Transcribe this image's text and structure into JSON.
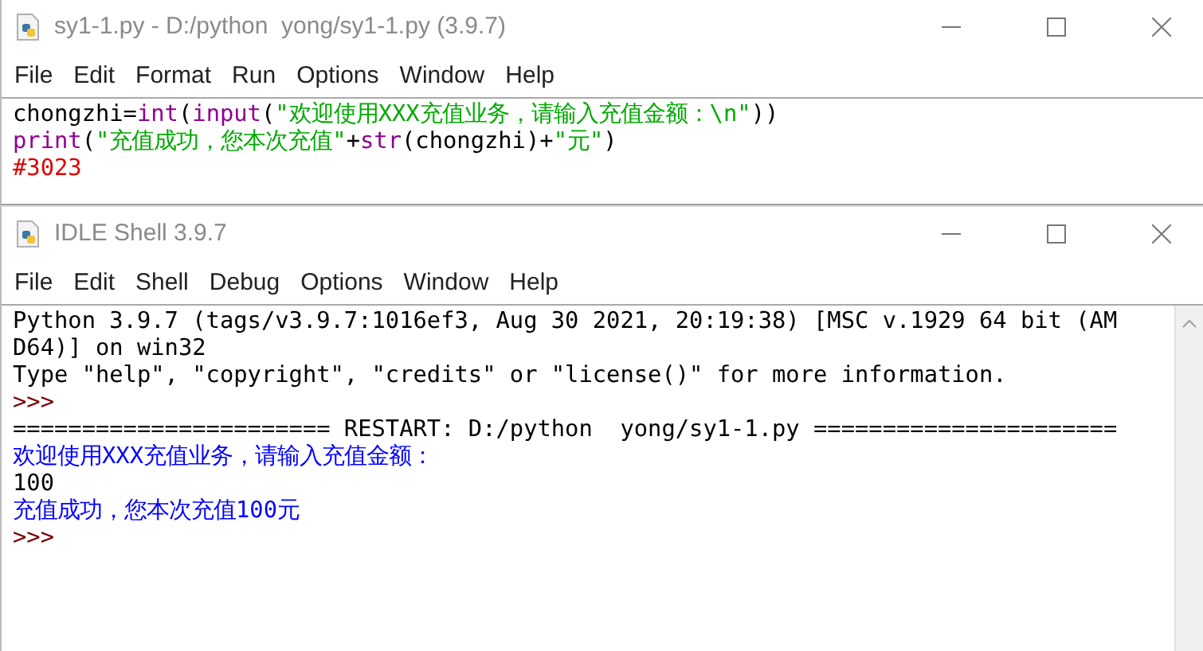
{
  "editor": {
    "title": "sy1-1.py - D:/python  yong/sy1-1.py (3.9.7)",
    "menu": [
      "File",
      "Edit",
      "Format",
      "Run",
      "Options",
      "Window",
      "Help"
    ],
    "lines": [
      [
        {
          "text": "chongzhi=",
          "kind": "plain"
        },
        {
          "text": "int",
          "kind": "builtin"
        },
        {
          "text": "(",
          "kind": "plain"
        },
        {
          "text": "input",
          "kind": "builtin"
        },
        {
          "text": "(",
          "kind": "plain"
        },
        {
          "text": "\"欢迎使用XXX充值业务，请输入充值金额：\\n\"",
          "kind": "string"
        },
        {
          "text": "))",
          "kind": "plain"
        }
      ],
      [
        {
          "text": "print",
          "kind": "builtin"
        },
        {
          "text": "(",
          "kind": "plain"
        },
        {
          "text": "\"充值成功，您本次充值\"",
          "kind": "string"
        },
        {
          "text": "+",
          "kind": "plain"
        },
        {
          "text": "str",
          "kind": "builtin"
        },
        {
          "text": "(chongzhi)+",
          "kind": "plain"
        },
        {
          "text": "\"元\"",
          "kind": "string"
        },
        {
          "text": ")",
          "kind": "plain"
        }
      ],
      [
        {
          "text": "#3023",
          "kind": "comment"
        }
      ]
    ]
  },
  "shell": {
    "title": "IDLE Shell 3.9.7",
    "menu": [
      "File",
      "Edit",
      "Shell",
      "Debug",
      "Options",
      "Window",
      "Help"
    ],
    "lines": [
      [
        {
          "text": "Python 3.9.7 (tags/v3.9.7:1016ef3, Aug 30 2021, 20:19:38) [MSC v.1929 64 bit (AM",
          "kind": "plain"
        }
      ],
      [
        {
          "text": "D64)] on win32",
          "kind": "plain"
        }
      ],
      [
        {
          "text": "Type \"help\", \"copyright\", \"credits\" or \"license()\" for more information.",
          "kind": "plain"
        }
      ],
      [
        {
          "text": ">>>",
          "kind": "prompt"
        }
      ],
      [
        {
          "text": "======================= RESTART: D:/python  yong/sy1-1.py ======================",
          "kind": "plain"
        }
      ],
      [
        {
          "text": "欢迎使用XXX充值业务，请输入充值金额：",
          "kind": "stdout"
        }
      ],
      [
        {
          "text": "100",
          "kind": "plain"
        }
      ],
      [
        {
          "text": "充值成功，您本次充值100元",
          "kind": "stdout"
        }
      ],
      [
        {
          "text": ">>>",
          "kind": "prompt"
        }
      ]
    ]
  }
}
